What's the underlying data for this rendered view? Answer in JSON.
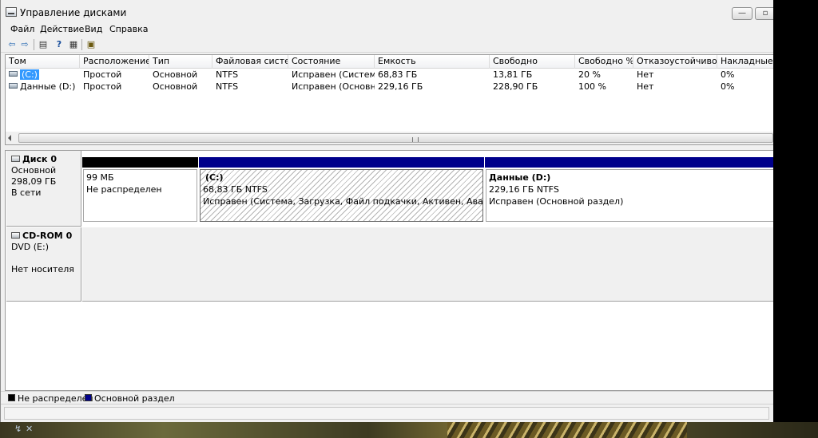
{
  "window": {
    "title": "Управление дисками",
    "buttons": {
      "minimize": "—",
      "restore": "▫"
    }
  },
  "menu": [
    "Файл",
    "Действие",
    "Вид",
    "Справка"
  ],
  "toolbar": {
    "back": "back-icon",
    "forward": "forward-icon",
    "icons": [
      "console-icon",
      "help-icon",
      "properties-icon",
      "properties2-icon"
    ]
  },
  "volume_list": {
    "columns": [
      "Том",
      "Расположение",
      "Тип",
      "Файловая систе...",
      "Состояние",
      "Емкость",
      "Свободно",
      "Свободно %",
      "Отказоустойчивос...",
      "Накладные ра"
    ],
    "rows": [
      [
        "(C:)",
        "Простой",
        "Основной",
        "NTFS",
        "Исправен (Систем...",
        "68,83 ГБ",
        "13,81 ГБ",
        "20 %",
        "Нет",
        "0%"
      ],
      [
        "Данные (D:)",
        "Простой",
        "Основной",
        "NTFS",
        "Исправен (Основн...",
        "229,16 ГБ",
        "228,90 ГБ",
        "100 %",
        "Нет",
        "0%"
      ]
    ],
    "selected_row": 0
  },
  "disks": [
    {
      "title": "Диск 0",
      "type": "Основной",
      "size": "298,09 ГБ",
      "status": "В сети",
      "partitions": [
        {
          "bar_color": "#000000",
          "label": "",
          "line1": "99 МБ",
          "line2": "Не распределен",
          "hatched": false
        },
        {
          "bar_color": "#00008b",
          "label": "(C:)",
          "line1": "68,83 ГБ NTFS",
          "line2": "Исправен (Система, Загрузка, Файл подкачки, Активен, Аварийный да",
          "hatched": true
        },
        {
          "bar_color": "#00008b",
          "label": "Данные  (D:)",
          "line1": "229,16 ГБ NTFS",
          "line2": "Исправен (Основной раздел)",
          "hatched": false
        }
      ]
    },
    {
      "title": "CD-ROM 0",
      "type": "DVD (E:)",
      "size": "",
      "status": "Нет носителя"
    }
  ],
  "legend": [
    {
      "color": "#000000",
      "label": "Не распределен"
    },
    {
      "color": "#00008b",
      "label": "Основной раздел"
    }
  ]
}
